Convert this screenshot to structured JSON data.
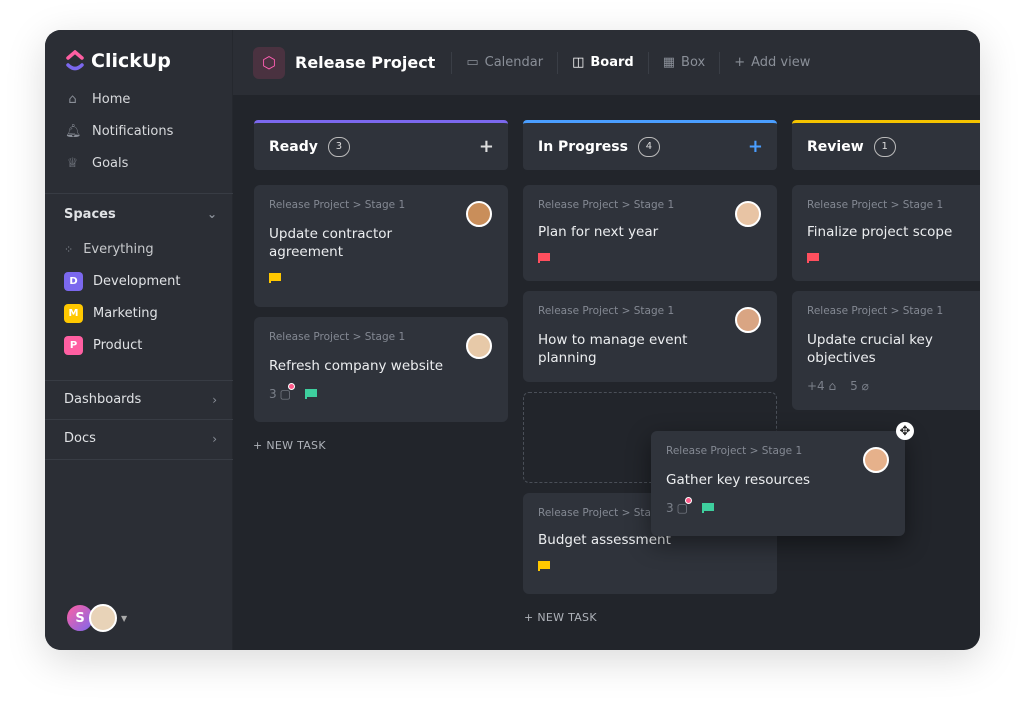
{
  "app": {
    "name": "ClickUp"
  },
  "sidebar": {
    "nav": [
      {
        "label": "Home",
        "icon": "home-icon"
      },
      {
        "label": "Notifications",
        "icon": "bell-icon"
      },
      {
        "label": "Goals",
        "icon": "trophy-icon"
      }
    ],
    "spaces_label": "Spaces",
    "everything_label": "Everything",
    "spaces": [
      {
        "letter": "D",
        "label": "Development",
        "color": "#7b68ee"
      },
      {
        "letter": "M",
        "label": "Marketing",
        "color": "#ffc800"
      },
      {
        "letter": "P",
        "label": "Product",
        "color": "#ff5fa2"
      }
    ],
    "dashboards_label": "Dashboards",
    "docs_label": "Docs",
    "user_initial": "S"
  },
  "header": {
    "project_title": "Release Project",
    "views": [
      {
        "label": "Calendar",
        "icon": "calendar-icon"
      },
      {
        "label": "Board",
        "icon": "board-icon",
        "active": true
      },
      {
        "label": "Box",
        "icon": "box-icon"
      }
    ],
    "add_view": "Add view"
  },
  "board": {
    "new_task": "+ NEW TASK",
    "columns": [
      {
        "name": "Ready",
        "count": "3",
        "color": "#7b68ee",
        "cards": [
          {
            "crumb": "Release Project > Stage 1",
            "title": "Update contractor agreement",
            "flag": "#ffc800"
          },
          {
            "crumb": "Release Project > Stage 1",
            "title": "Refresh company website",
            "comments": "3",
            "flag": "#3ecf9e"
          }
        ]
      },
      {
        "name": "In Progress",
        "count": "4",
        "color": "#4a9eff",
        "cards": [
          {
            "crumb": "Release Project > Stage 1",
            "title": "Plan for next year",
            "flag": "#ff4f5e"
          },
          {
            "crumb": "Release Project > Stage 1",
            "title": "How to manage event planning"
          },
          {
            "crumb": "Release Project > Stage 1",
            "title": "Budget assessment",
            "flag": "#ffc800"
          }
        ]
      },
      {
        "name": "Review",
        "count": "1",
        "color": "#f5c400",
        "cards": [
          {
            "crumb": "Release Project > Stage 1",
            "title": "Finalize project scope",
            "flag": "#ff4f5e"
          },
          {
            "crumb": "Release Project > Stage 1",
            "title": "Update crucial key objectives",
            "tags": "+4",
            "attachments": "5"
          }
        ]
      }
    ],
    "dragging": {
      "crumb": "Release Project > Stage 1",
      "title": "Gather key resources",
      "comments": "3",
      "flag": "#3ecf9e"
    }
  }
}
